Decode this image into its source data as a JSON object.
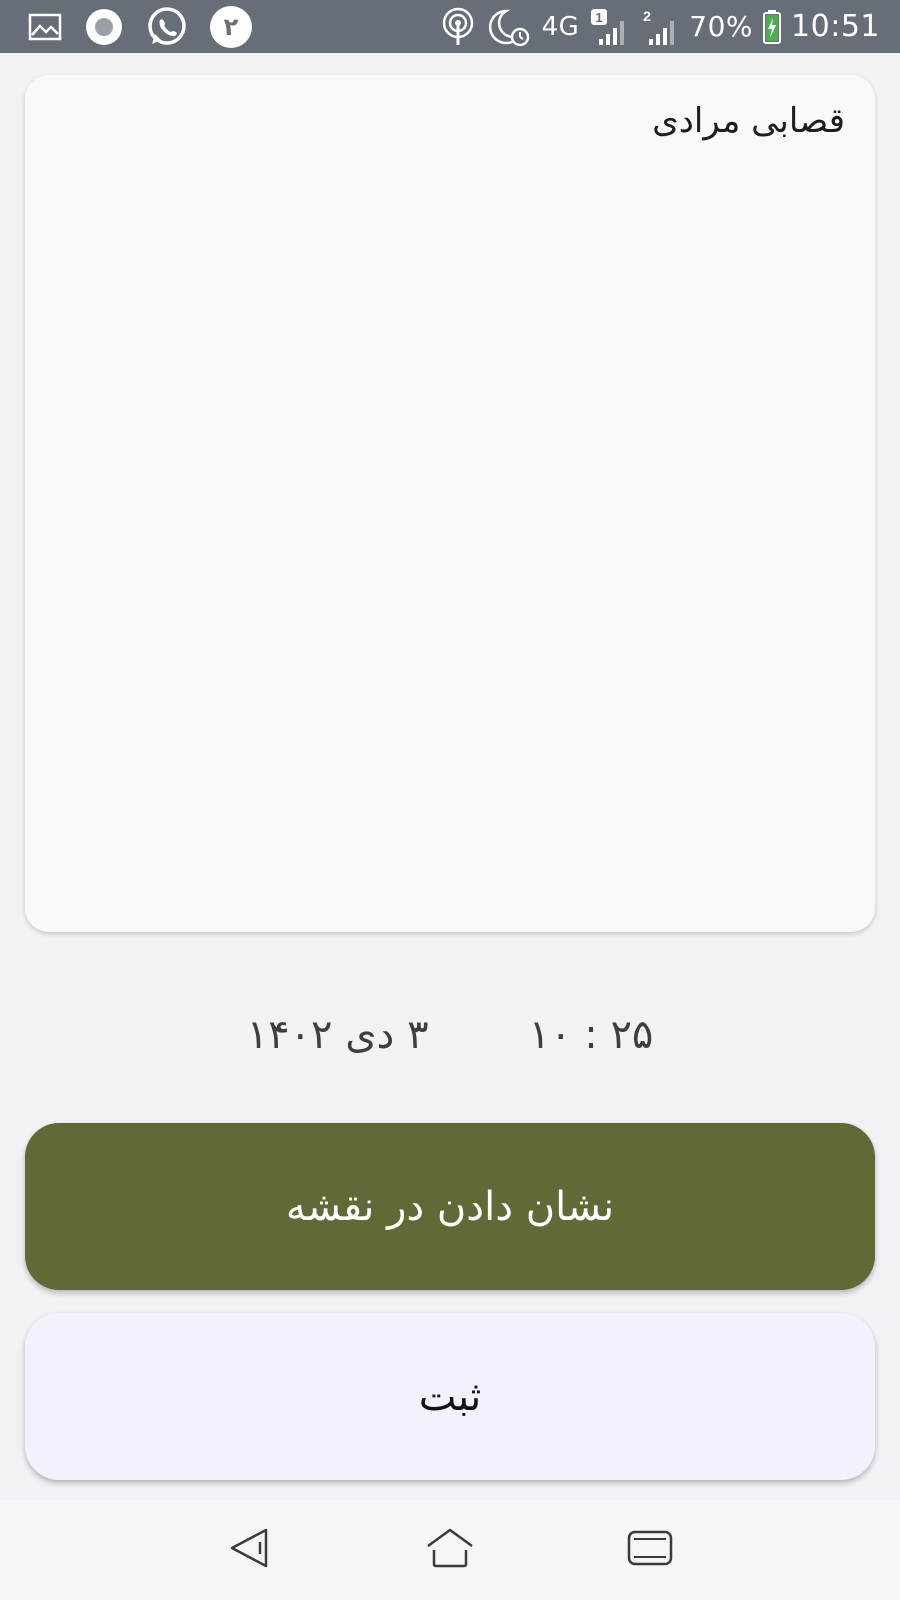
{
  "status_bar": {
    "notification_count": "۲",
    "network": "4G",
    "sim1_label": "1",
    "sim2_label": "2",
    "battery": "70%",
    "time": "10:51"
  },
  "card": {
    "text": "قصابی مرادی"
  },
  "datetime": {
    "date": "۳ دی ۱۴۰۲",
    "time": "۲۵ : ۱۰"
  },
  "buttons": {
    "show_on_map": "نشان دادن در نقشه",
    "submit": "ثبت"
  },
  "colors": {
    "status_bar": "#676e77",
    "primary_button": "#5e6b37",
    "secondary_button": "#f0f2fc",
    "battery_charging": "#4caf50"
  }
}
